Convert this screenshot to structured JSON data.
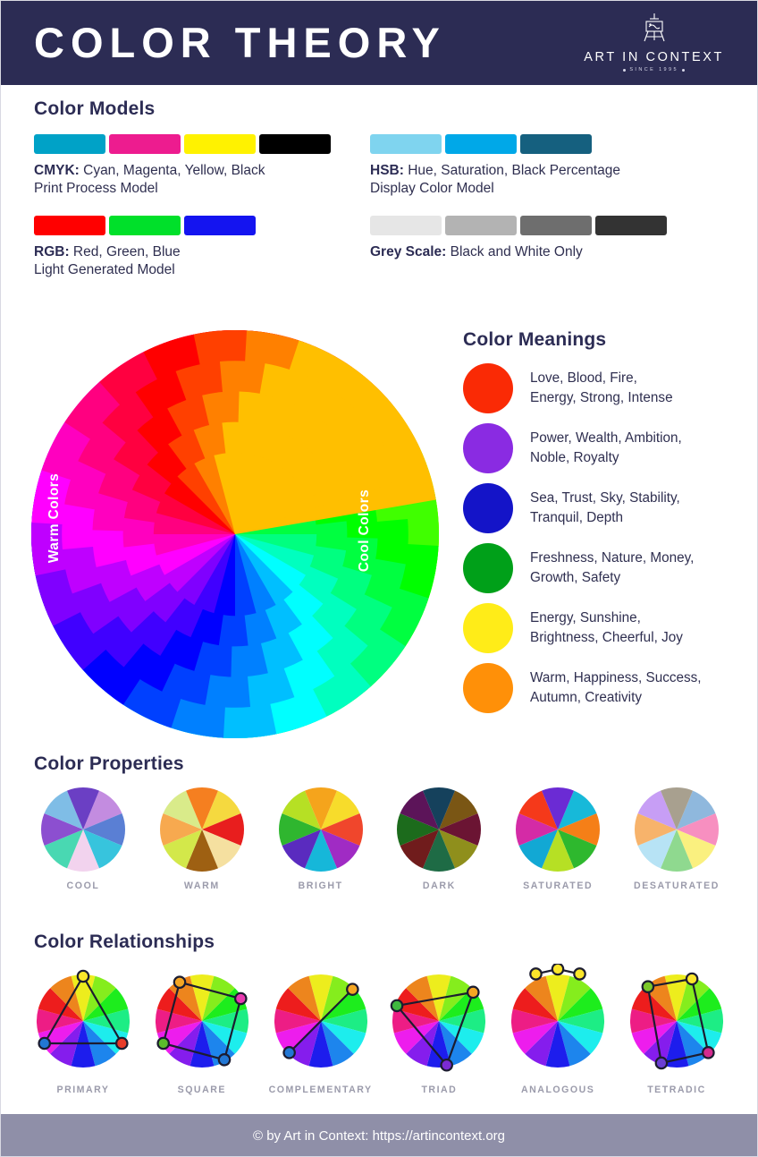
{
  "header": {
    "title": "COLOR THEORY",
    "logo_name": "ART IN CONTEXT",
    "logo_tagline": "SINCE 1995",
    "bg_color": "#2c2c54"
  },
  "models": {
    "title": "Color Models",
    "entries": [
      {
        "key": "cmyk",
        "abbr": "CMYK:",
        "expansion": " Cyan, Magenta, Yellow, Black",
        "subtitle": "Print Process Model",
        "swatches": [
          "#00a2c7",
          "#ed1c8f",
          "#fff200",
          "#000000"
        ],
        "widths": [
          80,
          80,
          80,
          80
        ]
      },
      {
        "key": "rgb",
        "abbr": "RGB:",
        "expansion": " Red, Green, Blue",
        "subtitle": "Light Generated Model",
        "swatches": [
          "#ff0000",
          "#00e02a",
          "#1414f0"
        ],
        "widths": [
          80,
          80,
          80
        ]
      },
      {
        "key": "hsb",
        "abbr": "HSB:",
        "expansion": " Hue, Saturation, Black Percentage",
        "subtitle": "Display Color Model",
        "swatches": [
          "#7fd4ef",
          "#00a8e8",
          "#15607f"
        ],
        "widths": [
          80,
          80,
          80
        ]
      },
      {
        "key": "greyscale",
        "abbr": "Grey Scale:",
        "expansion": " Black and White Only",
        "subtitle": "",
        "swatches": [
          "#e6e6e6",
          "#b3b3b3",
          "#6e6e6e",
          "#333333"
        ],
        "widths": [
          80,
          80,
          80,
          80
        ]
      }
    ]
  },
  "wheel": {
    "warm_label": "Warm Colors",
    "cool_label": "Cool Colors"
  },
  "meanings": {
    "title": "Color Meanings",
    "items": [
      {
        "color": "#fa2a05",
        "name": "red",
        "text": "Love, Blood, Fire,\nEnergy, Strong, Intense"
      },
      {
        "color": "#8a2be2",
        "name": "purple",
        "text": "Power, Wealth, Ambition,\nNoble, Royalty"
      },
      {
        "color": "#1414c8",
        "name": "blue",
        "text": "Sea, Trust, Sky, Stability,\nTranquil, Depth"
      },
      {
        "color": "#00a019",
        "name": "green",
        "text": "Freshness, Nature, Money,\nGrowth, Safety"
      },
      {
        "color": "#ffec18",
        "name": "yellow",
        "text": "Energy, Sunshine,\nBrightness, Cheerful, Joy"
      },
      {
        "color": "#ff9008",
        "name": "orange",
        "text": "Warm, Happiness, Success,\nAutumn, Creativity"
      }
    ]
  },
  "properties": {
    "title": "Color Properties",
    "items": [
      {
        "label": "COOL",
        "colors": [
          "#c38ce0",
          "#5a7fd4",
          "#37c4dd",
          "#f2d3ee",
          "#49d8b2",
          "#8c4fd0",
          "#7fbde6",
          "#6b3fc4"
        ]
      },
      {
        "label": "WARM",
        "colors": [
          "#f5d93f",
          "#e81e1e",
          "#f5e0a0",
          "#9e6012",
          "#d3e84a",
          "#f7a94f",
          "#d9eb8a",
          "#f57f20"
        ]
      },
      {
        "label": "BRIGHT",
        "colors": [
          "#f7dc2b",
          "#f0462c",
          "#a02bc4",
          "#16b7d9",
          "#5a2bbf",
          "#2fb62f",
          "#b6e024",
          "#f5a41c"
        ]
      },
      {
        "label": "DARK",
        "colors": [
          "#7a5614",
          "#6b1433",
          "#8f8f1c",
          "#1e6b45",
          "#701c1c",
          "#1c6b1c",
          "#5c1459",
          "#15415c"
        ]
      },
      {
        "label": "SATURATED",
        "colors": [
          "#17b9d9",
          "#f57f17",
          "#2eb82e",
          "#b6e024",
          "#12a8d4",
          "#d42ba6",
          "#f5391a",
          "#6b2bd4"
        ]
      },
      {
        "label": "DESATURATED",
        "colors": [
          "#8fb8dd",
          "#f78fc0",
          "#faf07f",
          "#8fd98f",
          "#b7e3f5",
          "#f7b36b",
          "#c79ef5",
          "#a8a08f"
        ]
      }
    ]
  },
  "relationships": {
    "title": "Color Relationships",
    "items": [
      {
        "label": "PRIMARY",
        "nodes_deg": [
          0,
          120,
          240
        ],
        "node_colors": [
          "#fbe62b",
          "#e83a28",
          "#2277d4"
        ],
        "closed": true
      },
      {
        "label": "SQUARE",
        "nodes_deg": [
          330,
          60,
          150,
          240
        ],
        "node_colors": [
          "#f5a623",
          "#e83ab0",
          "#2277d4",
          "#5bbd2b"
        ],
        "closed": true
      },
      {
        "label": "COMPLEMENTARY",
        "nodes_deg": [
          45,
          225
        ],
        "node_colors": [
          "#f5a623",
          "#2277d4"
        ],
        "closed": false
      },
      {
        "label": "TRIAD",
        "nodes_deg": [
          50,
          170,
          290
        ],
        "node_colors": [
          "#f5a623",
          "#7b2bd4",
          "#3fb83f"
        ],
        "closed": true
      },
      {
        "label": "ANALOGOUS",
        "nodes_deg": [
          335,
          0,
          25
        ],
        "node_colors": [
          "#fbe62b",
          "#fbe62b",
          "#fbe62b"
        ],
        "closed": false,
        "outside": true
      },
      {
        "label": "TETRADIC",
        "nodes_deg": [
          20,
          135,
          200,
          320
        ],
        "node_colors": [
          "#fbe62b",
          "#d42b8f",
          "#6b3fd4",
          "#7bc82b"
        ],
        "closed": true
      }
    ]
  },
  "footer": {
    "text": "© by Art in Context: https://artincontext.org",
    "bg_color": "#8f8fa8"
  }
}
